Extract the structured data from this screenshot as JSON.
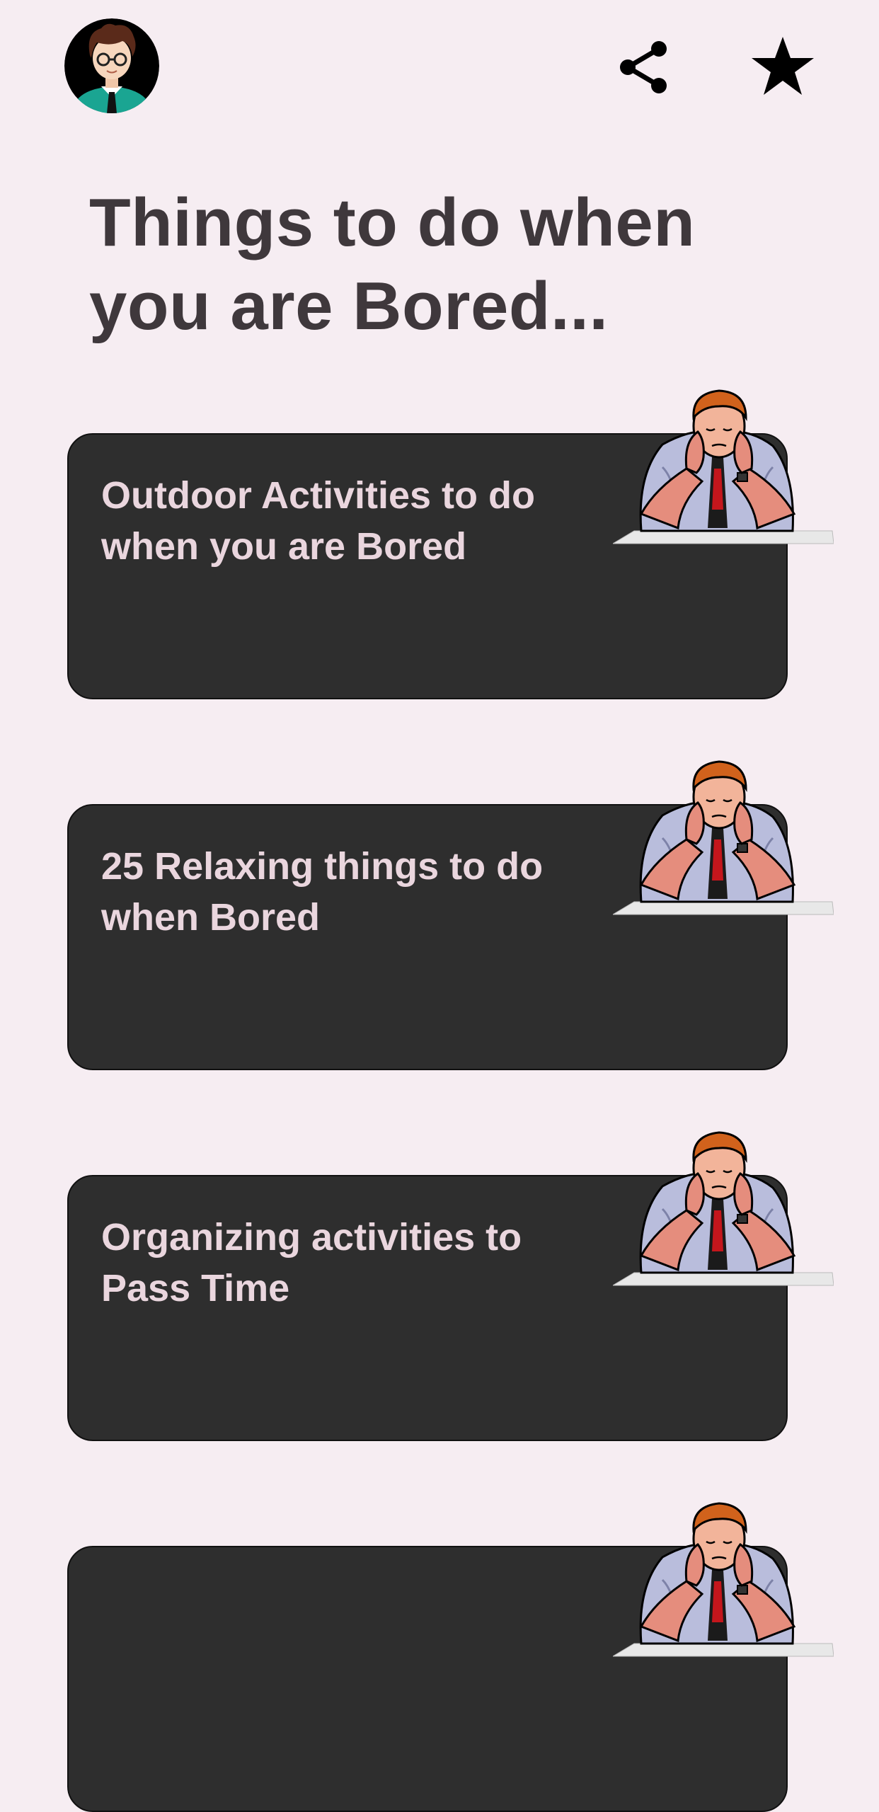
{
  "header": {
    "avatar_icon": "user-avatar-icon",
    "share_icon": "share-icon",
    "favorite_icon": "star-icon"
  },
  "page": {
    "title": "Things to do when you are Bored..."
  },
  "cards": [
    {
      "title": "Outdoor Activities to do when you are Bored",
      "icon": "bored-man-illustration"
    },
    {
      "title": "25 Relaxing things to do when Bored",
      "icon": "bored-man-illustration"
    },
    {
      "title": "Organizing activities to Pass Time",
      "icon": "bored-man-illustration"
    },
    {
      "title": "",
      "icon": "bored-man-illustration"
    }
  ],
  "colors": {
    "background": "#f6edf2",
    "card": "#2e2e2e",
    "card_text": "#ead6de",
    "title_text": "#3f383c"
  }
}
